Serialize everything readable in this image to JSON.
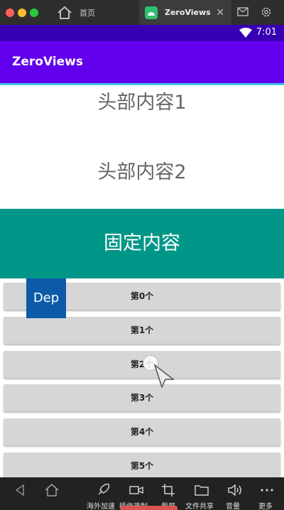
{
  "window": {
    "home_tab": "首页",
    "active_tab": "ZeroViews",
    "close_glyph": "✕"
  },
  "statusbar": {
    "time": "7:01"
  },
  "appbar": {
    "title": "ZeroViews"
  },
  "content": {
    "header_items": [
      "头部内容1",
      "头部内容2"
    ],
    "sticky": "固定内容",
    "floating_label": "Dep",
    "list_items": [
      "第0个",
      "第1个",
      "第2个",
      "第3个",
      "第4个",
      "第5个"
    ]
  },
  "toolbar": {
    "items": [
      "海外加速",
      "操作录制",
      "截屏",
      "文件共享",
      "音量",
      "更多"
    ]
  },
  "colors": {
    "status_bar": "#3700b3",
    "app_bar": "#6200ee",
    "sticky": "#009688",
    "floating": "#0c5ba8"
  },
  "icons": [
    "home-icon",
    "app-icon",
    "close-icon",
    "mail-icon",
    "gear-icon",
    "wifi-icon",
    "back-icon",
    "house-icon",
    "rocket-icon",
    "video-icon",
    "crop-icon",
    "folder-icon",
    "volume-icon",
    "more-icon"
  ]
}
